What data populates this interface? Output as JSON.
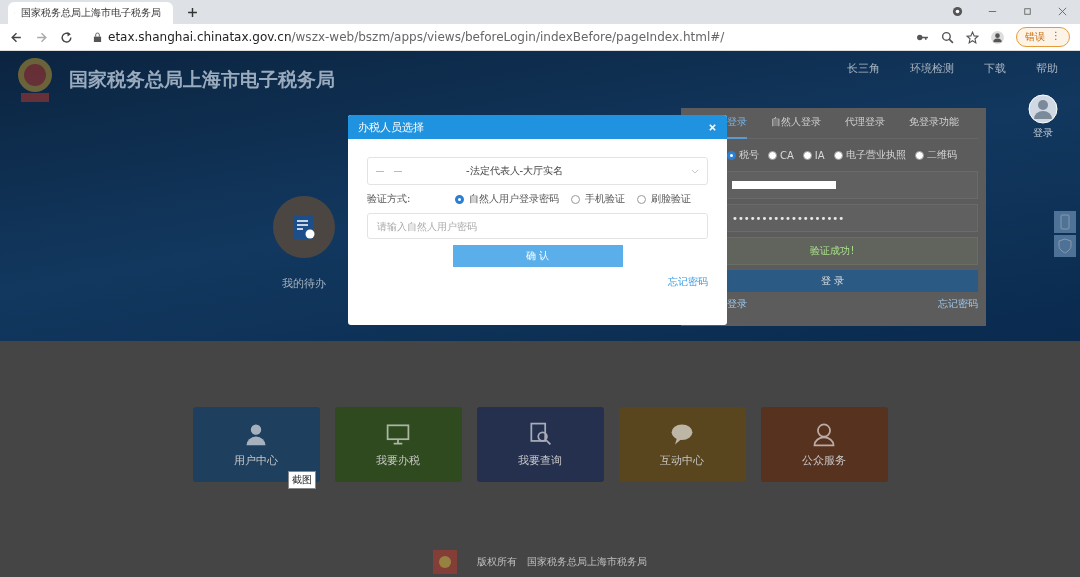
{
  "browser": {
    "tab_title": "国家税务总局上海市电子税务局",
    "url_host": "etax.shanghai.chinatax.gov.cn",
    "url_path": "/wszx-web/bszm/apps/views/beforeLogin/indexBefore/pageIndex.html#/",
    "translate_button": "错误",
    "translate_menu": "⋮"
  },
  "header": {
    "title": "国家税务总局上海市电子税务局",
    "links": [
      "长三角",
      "环境检测",
      "下载",
      "帮助"
    ],
    "avatar_label": "登录"
  },
  "todo": {
    "label": "我的待办"
  },
  "login_panel": {
    "tabs": [
      {
        "label": "登录",
        "selected": true
      },
      {
        "label": "自然人登录",
        "selected": false
      },
      {
        "label": "代理登录",
        "selected": false
      },
      {
        "label": "免登录功能",
        "selected": false
      }
    ],
    "methods": [
      {
        "label": "税号",
        "selected": true
      },
      {
        "label": "CA",
        "selected": false
      },
      {
        "label": "IA",
        "selected": false
      },
      {
        "label": "电子营业执照",
        "selected": false
      },
      {
        "label": "二维码",
        "selected": false
      }
    ],
    "password": "•••••••••••••••••••",
    "status": "验证成功!",
    "login_button": "登 录",
    "left_link": "登录",
    "forgot_link": "忘记密码"
  },
  "tiles": [
    {
      "label": "用户中心",
      "color": "#1f3f5e"
    },
    {
      "label": "我要办税",
      "color": "#2f4a1e"
    },
    {
      "label": "我要查询",
      "color": "#25304f"
    },
    {
      "label": "互动中心",
      "color": "#5a461e"
    },
    {
      "label": "公众服务",
      "color": "#56321f"
    }
  ],
  "tooltip": "截图",
  "footer": {
    "copyright": "版权所有",
    "org": "国家税务总局上海市税务局"
  },
  "modal": {
    "title": "办税人员选择",
    "select_value": "-法定代表人-大厅实名",
    "verify_label": "验证方式:",
    "verify_options": [
      {
        "label": "自然人用户登录密码",
        "selected": true
      },
      {
        "label": "手机验证",
        "selected": false
      },
      {
        "label": "刷脸验证",
        "selected": false
      }
    ],
    "password_placeholder": "请输入自然人用户密码",
    "confirm_button": "确 认",
    "forgot_link": "忘记密码"
  }
}
